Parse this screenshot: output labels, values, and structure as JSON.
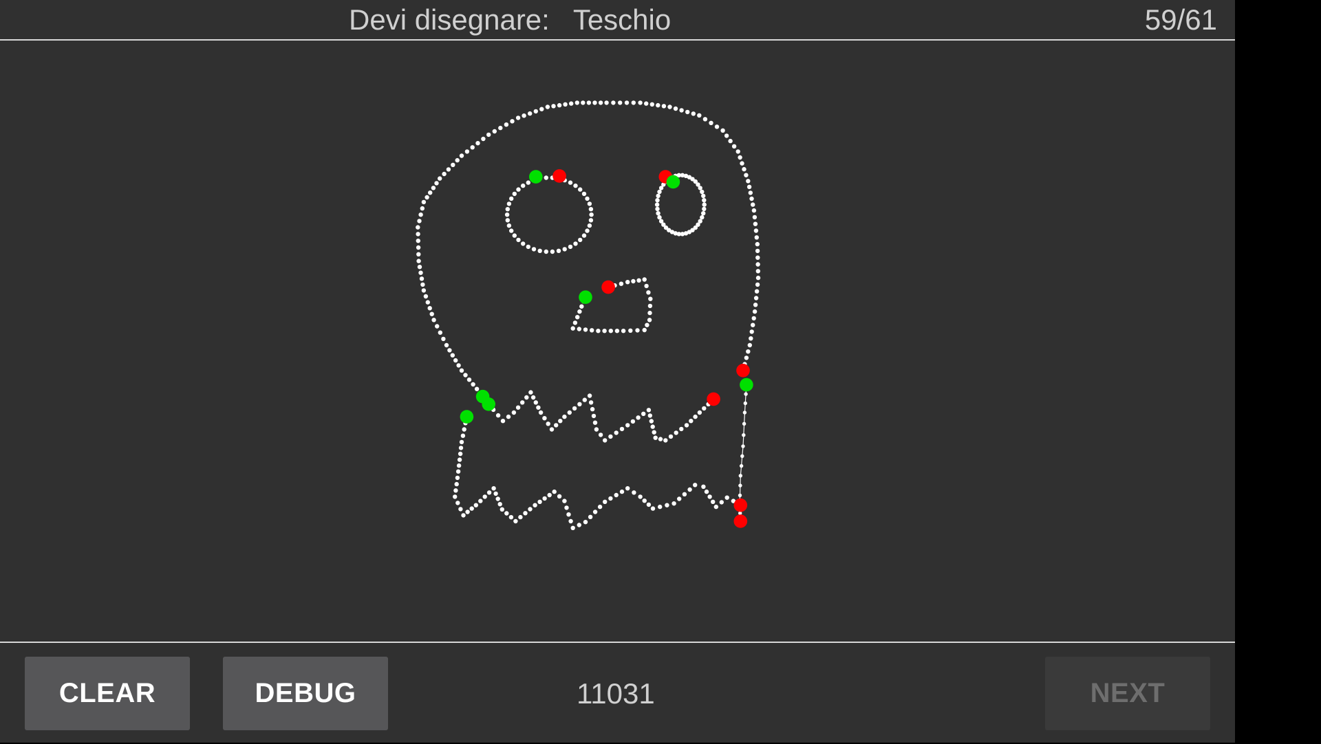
{
  "header": {
    "prompt_label": "Devi disegnare:",
    "prompt_word": "Teschio",
    "progress": "59/61"
  },
  "toolbar": {
    "clear_label": "CLEAR",
    "debug_label": "DEBUG",
    "score": "11031",
    "next_label": "NEXT",
    "next_enabled": false
  },
  "colors": {
    "background": "#303030",
    "stroke_point": "#ffffff",
    "stroke_start": "#00e000",
    "stroke_end": "#ff0000",
    "button": "#565658",
    "button_disabled": "#3a3a3a"
  },
  "drawing": {
    "description_icon": "skull-sketch"
  }
}
